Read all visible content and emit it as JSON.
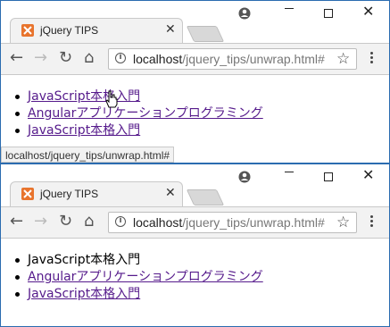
{
  "windows": [
    {
      "tab": {
        "title": "jQuery TIPS"
      },
      "address": {
        "host": "localhost",
        "path": "/jquery_tips/unwrap.html#"
      },
      "list": [
        {
          "text": "JavaScript本格入門",
          "link": true
        },
        {
          "text": "Angularアプリケーションプログラミング",
          "link": true
        },
        {
          "text": "JavaScript本格入門",
          "link": true
        }
      ],
      "status": "localhost/jquery_tips/unwrap.html#"
    },
    {
      "tab": {
        "title": "jQuery TIPS"
      },
      "address": {
        "host": "localhost",
        "path": "/jquery_tips/unwrap.html#"
      },
      "list": [
        {
          "text": "JavaScript本格入門",
          "link": false
        },
        {
          "text": "Angularアプリケーションプログラミング",
          "link": true
        },
        {
          "text": "JavaScript本格入門",
          "link": true
        }
      ]
    }
  ],
  "icons": {
    "favicon": "xampp-icon",
    "account": "account-icon",
    "back": "back-arrow-icon",
    "forward": "forward-arrow-icon",
    "reload": "reload-icon",
    "home": "home-icon",
    "info": "info-icon",
    "star": "star-icon",
    "menu": "menu-dots-icon"
  },
  "colors": {
    "link": "#551a8b",
    "favicon": "#e8742d",
    "window_border": "#2b6cb0"
  }
}
